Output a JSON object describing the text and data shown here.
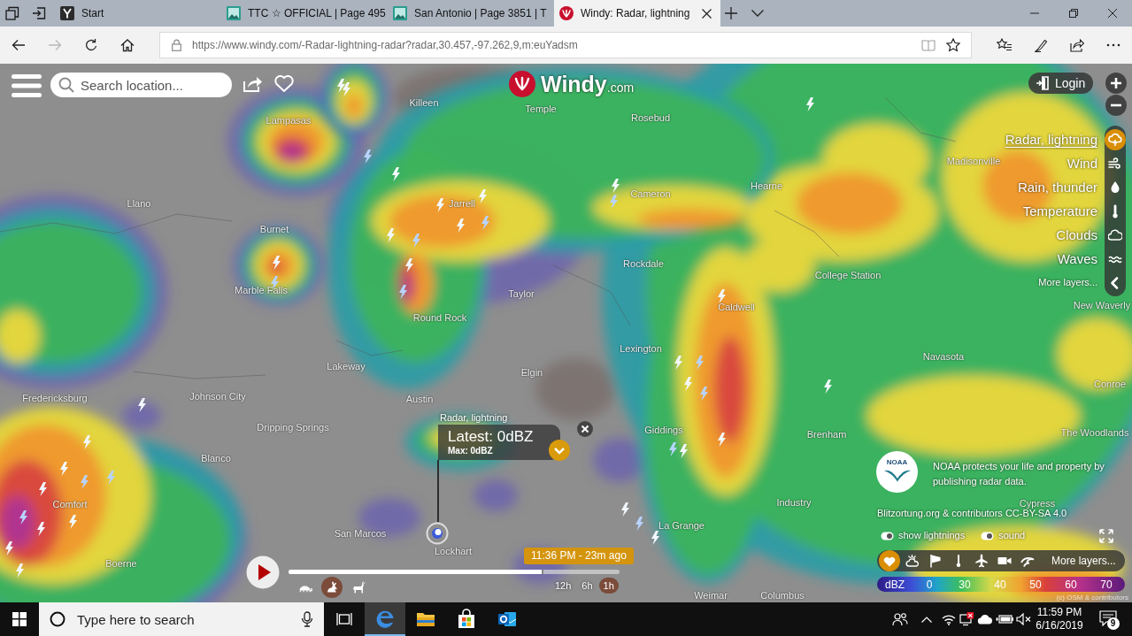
{
  "browser": {
    "tabs": [
      {
        "title": "Start",
        "kind": "start",
        "selected": false
      },
      {
        "title": "TTC ☆ OFFICIAL | Page 495",
        "kind": "image",
        "selected": false
      },
      {
        "title": "San Antonio | Page 3851 | T",
        "kind": "image",
        "selected": false
      },
      {
        "title": "Windy: Radar, lightning",
        "kind": "windy",
        "selected": true
      }
    ],
    "nav": [
      {
        "kind": "back",
        "disabled": false
      },
      {
        "kind": "forward",
        "disabled": true
      },
      {
        "kind": "refresh",
        "disabled": false
      },
      {
        "kind": "home",
        "disabled": false
      }
    ],
    "url": "https://www.windy.com/-Radar-lightning-radar?radar,30.457,-97.262,9,m:euYadsm"
  },
  "map_labels": [
    "Killeen",
    "Temple",
    "Lampasas",
    "Rosebud",
    "Madisonville",
    "Cameron",
    "Hearne",
    "Llano",
    "Jarrell",
    "Burnet",
    "Rockdale",
    "College Station",
    "Marble Falls",
    "Taylor",
    "Caldwell",
    "New Waverly",
    "Round Rock",
    "Lexington",
    "Navasota",
    "Lakeway",
    "Elgin",
    "Conroe",
    "Fredericksburg",
    "Johnson City",
    "Austin",
    "Dripping Springs",
    "Giddings",
    "Brenham",
    "The Woodlands",
    "Blanco",
    "Comfort",
    "Industry",
    "Cypress",
    "San Marcos",
    "La Grange",
    "Lockhart",
    "Boerne",
    "Weimar",
    "Columbus"
  ],
  "search": {
    "placeholder": "Search location..."
  },
  "logo": {
    "name": "Windy",
    "suffix": ".com"
  },
  "login": "Login",
  "layers": {
    "items": [
      {
        "label": "Radar, lightning",
        "kind": "radar",
        "selected": true
      },
      {
        "label": "Wind",
        "kind": "wind",
        "selected": false
      },
      {
        "label": "Rain, thunder",
        "kind": "rain",
        "selected": false
      },
      {
        "label": "Temperature",
        "kind": "temperature",
        "selected": false
      },
      {
        "label": "Clouds",
        "kind": "clouds",
        "selected": false
      },
      {
        "label": "Waves",
        "kind": "waves",
        "selected": false
      }
    ],
    "more": "More layers..."
  },
  "popup": {
    "title": "Radar, lightning",
    "latest": "Latest: 0dBZ",
    "max": "Max: 0dBZ"
  },
  "credits": {
    "logo": "NOAA",
    "noaa": "NOAA protects your life and property by publishing radar data.",
    "lightning": "Blitzortung.org & contributors CC-BY-SA 4.0",
    "map": "(c) OSM & contributors"
  },
  "toggles": [
    {
      "label": "show lightnings",
      "on": true
    },
    {
      "label": "sound",
      "on": true
    }
  ],
  "overlay_bar": {
    "items": [
      {
        "kind": "favorites",
        "selected": true
      },
      {
        "kind": "weather",
        "selected": false
      },
      {
        "kind": "windsock",
        "selected": false
      },
      {
        "kind": "thermometer",
        "selected": false
      },
      {
        "kind": "airplane",
        "selected": false
      },
      {
        "kind": "camera",
        "selected": false
      },
      {
        "kind": "surf",
        "selected": false
      }
    ],
    "more": "More layers..."
  },
  "legend": {
    "unit": "dBZ",
    "ticks": [
      "0",
      "30",
      "40",
      "50",
      "60",
      "70"
    ]
  },
  "timeline": {
    "level": 0.77,
    "time": "11:36 PM - 23m ago",
    "speeds": [
      {
        "kind": "slow",
        "selected": false
      },
      {
        "kind": "medium",
        "selected": true
      },
      {
        "kind": "fast",
        "selected": false
      }
    ],
    "ranges": [
      {
        "label": "12h",
        "selected": false
      },
      {
        "label": "6h",
        "selected": false
      },
      {
        "label": "1h",
        "selected": true
      }
    ]
  },
  "taskbar": {
    "search": {
      "placeholder": "Type here to search"
    },
    "apps": [
      {
        "kind": "edge",
        "selected": true
      },
      {
        "kind": "explorer",
        "selected": false
      },
      {
        "kind": "store",
        "selected": false
      },
      {
        "kind": "outlook",
        "selected": false
      }
    ],
    "clock": {
      "time": "11:59 PM",
      "date": "6/16/2019"
    },
    "notifications": "9"
  }
}
